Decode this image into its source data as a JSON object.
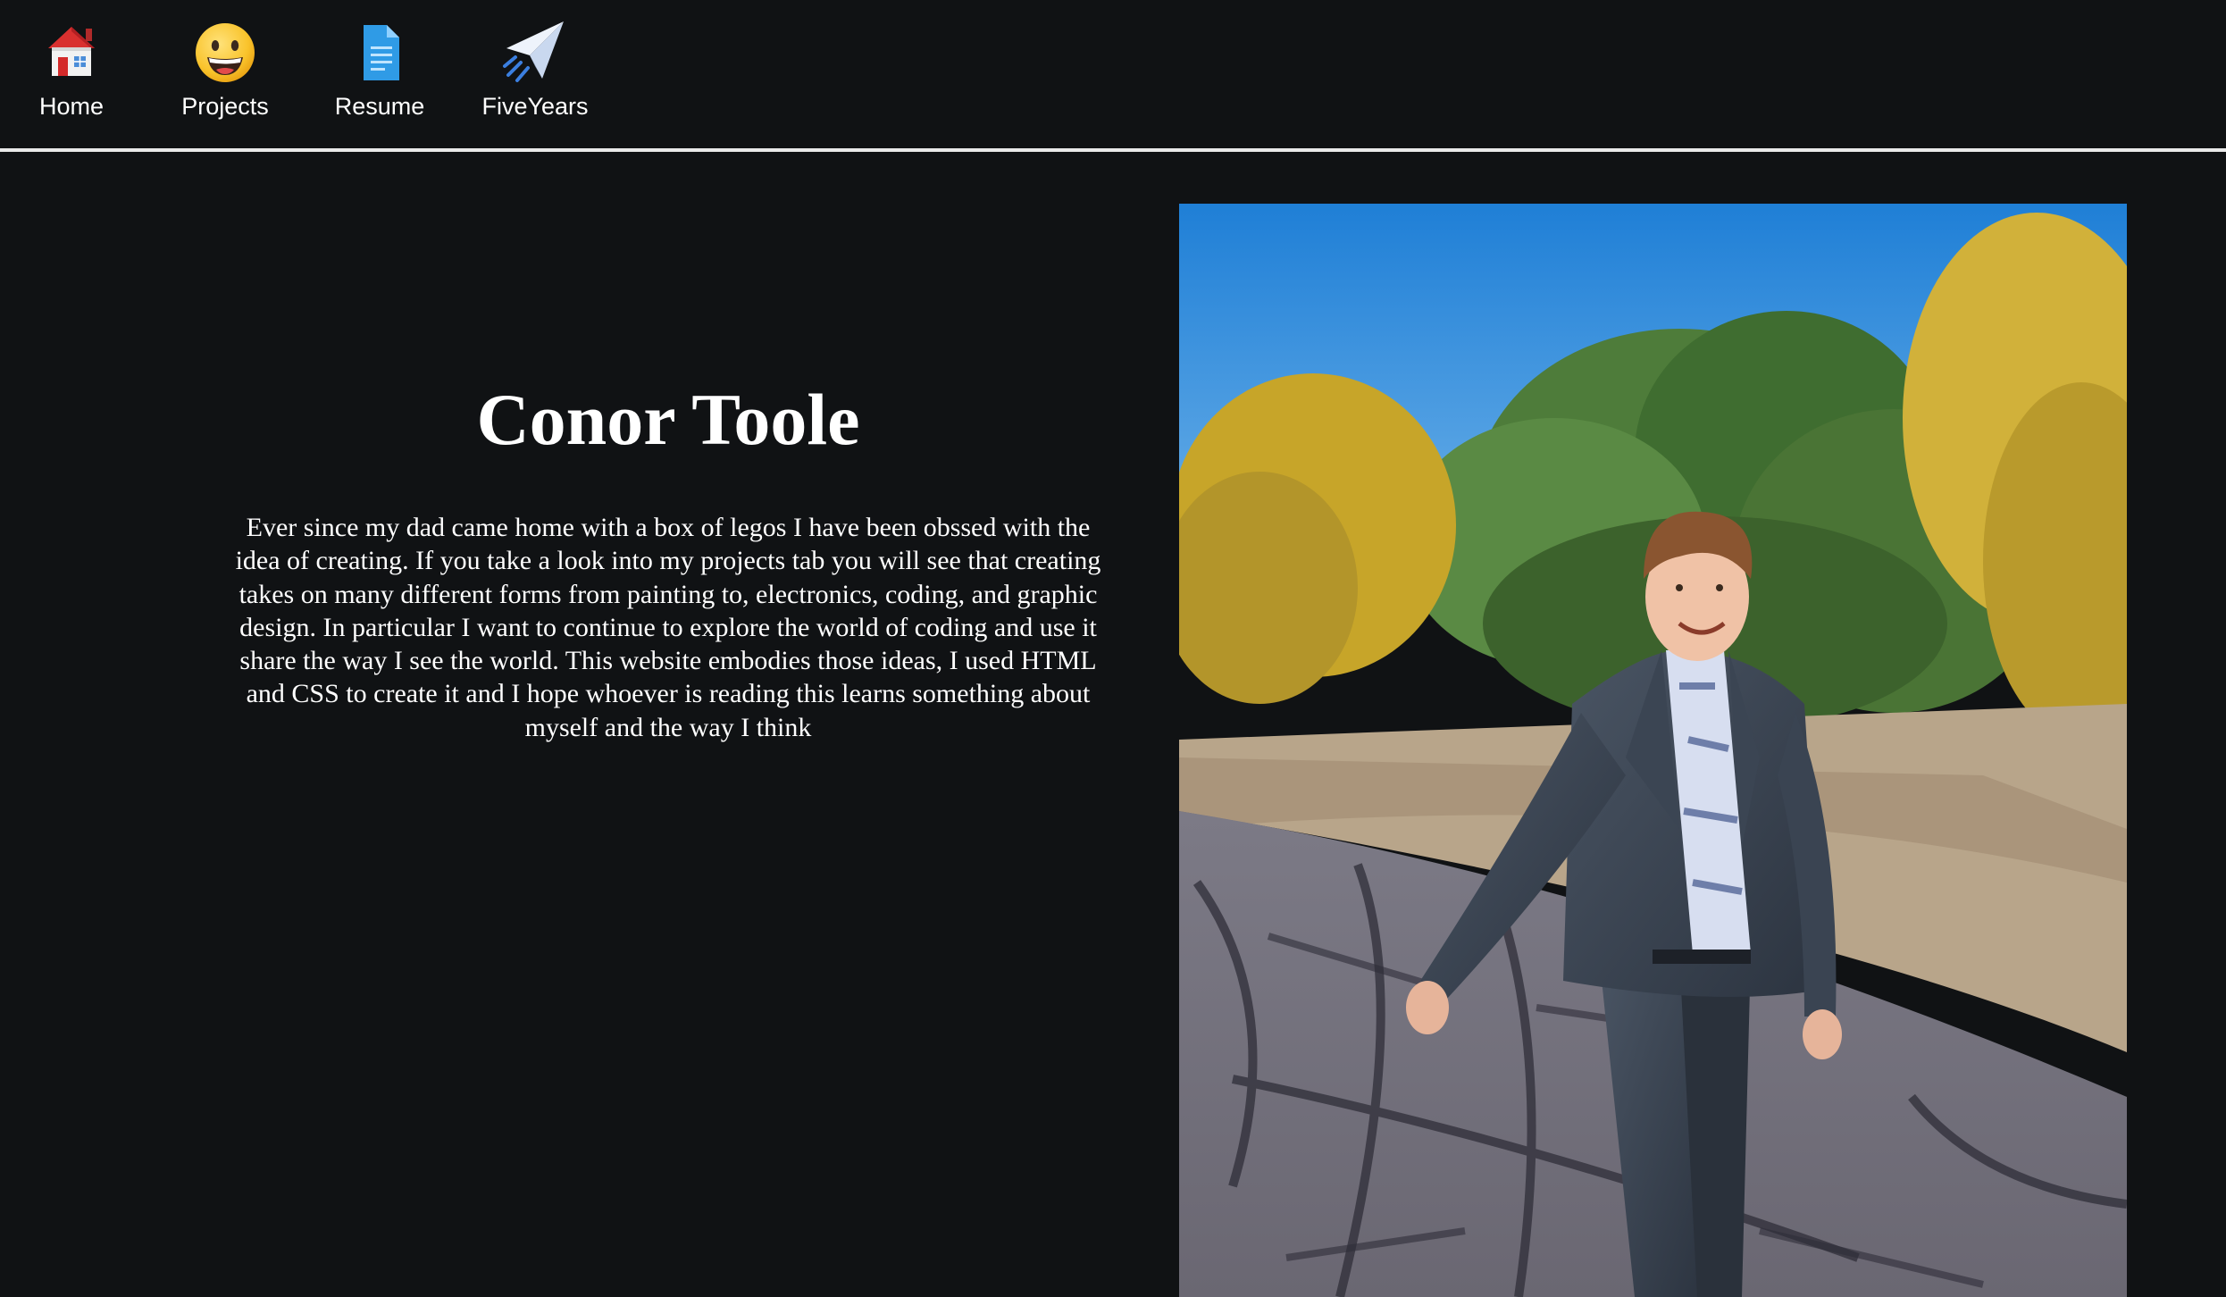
{
  "nav": {
    "items": [
      {
        "label": "Home",
        "icon": "house-icon"
      },
      {
        "label": "Projects",
        "icon": "grinning-face-icon"
      },
      {
        "label": "Resume",
        "icon": "document-icon"
      },
      {
        "label": "FiveYears",
        "icon": "paper-plane-icon"
      }
    ]
  },
  "hero": {
    "title": "Conor Toole",
    "bio": "Ever since my dad came home with a box of legos I have been obssed with the idea of creating. If you take a look into my projects tab you will see that creating takes on many different forms from painting to, electronics, coding, and graphic design. In particular I want to continue to explore the world of coding and use it share the way I see the world. This website embodies those ideas, I used HTML and CSS to create it and I hope whoever is reading this learns something about myself and the way I think"
  },
  "photo": {
    "subject": "portrait-photo"
  },
  "colors": {
    "background": "#101214",
    "text": "#ffffff",
    "divider": "#e9e9e9"
  }
}
